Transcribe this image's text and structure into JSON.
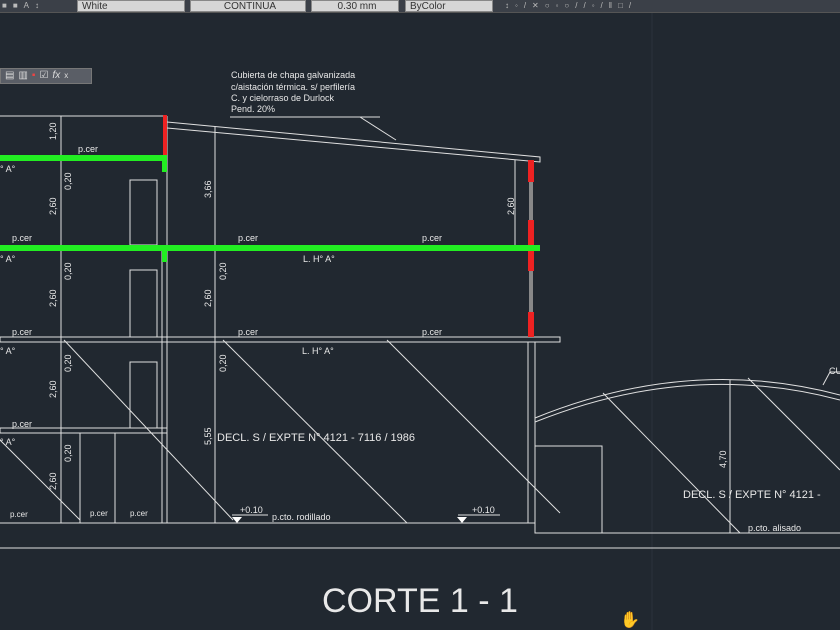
{
  "toolbar": {
    "color": "White",
    "linetype": "CONTINUA",
    "lineweight": "0.30 mm",
    "plotstyle": "ByColor"
  },
  "float_toolbar": {
    "close": "x",
    "fx": "fx"
  },
  "drawing": {
    "roof_note": [
      "Cubierta de chapa galvanizada",
      "c/aistación térmica. s/ perfilería",
      "C. y cielorraso de Durlock",
      "Pend. 20%"
    ],
    "dims": {
      "d120": "1,20",
      "d020": "0,20",
      "d260": "2,60",
      "d366": "3,66",
      "d555": "5,55",
      "d470": "4,70"
    },
    "pcer": "p.cer",
    "lha": "L. H° A°",
    "lha_partial": "° A°",
    "decl": "DECL.  S / EXPTE N° 4121 - 7116 / 1986",
    "decl_partial": "DECL.  S / EXPTE N° 4121 -",
    "level": "+0.10",
    "rodillado": "p.cto. rodillado",
    "alisado": "p.cto. alisado",
    "cu": "CU",
    "title": "CORTE  1 - 1"
  },
  "colors": {
    "background": "#212830",
    "slab": "#22ee22",
    "column": "#ee2222",
    "line": "#e0e0e0"
  }
}
